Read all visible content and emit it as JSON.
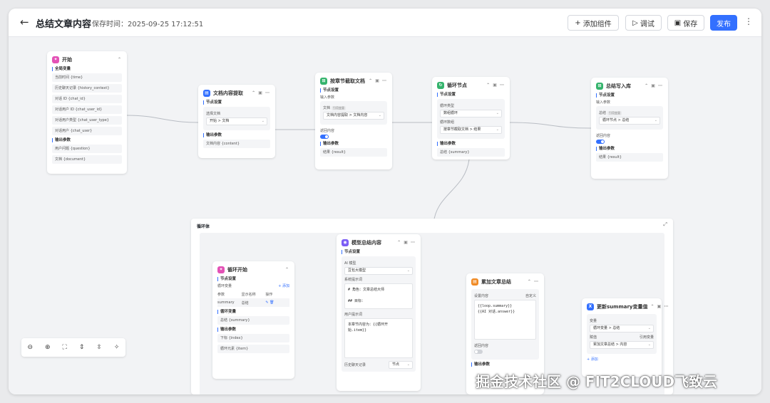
{
  "header": {
    "back_icon": "←",
    "title": "总结文章内容",
    "save_time_label": "保存时间：",
    "save_time": "2025-09-25 17:12:51",
    "add_component": "添加组件",
    "debug": "调试",
    "save": "保存",
    "publish": "发布",
    "more_icon": "⋮",
    "accent_color": "#3370ff"
  },
  "nodes": {
    "start": {
      "title": "开始",
      "global_vars_label": "全局变量",
      "global_vars": [
        "当前时间 {time}",
        "历史聊天记录 {history_context}",
        "对话 ID {chat_id}",
        "对话用户 ID {chat_user_id}",
        "对话用户类型 {chat_user_type}",
        "对话用户 {chat_user}"
      ],
      "output_label": "输出参数",
      "outputs": [
        "用户问题 {question}",
        "文档 {document}"
      ]
    },
    "doc_extract": {
      "title": "文档内容提取",
      "node_settings": "节点设置",
      "select_doc_label": "选择文档",
      "select_doc_value": "开始 > 文档",
      "output_label": "输出参数",
      "output": "文档内容 {content}"
    },
    "chapter_extract": {
      "title": "按章节截取文档",
      "node_settings": "节点设置",
      "input_label": "输入参数",
      "doc_label": "文档",
      "doc_tag": "引用变量",
      "doc_value": "文档内容提取 > 文档内容",
      "return_label": "返回内容",
      "output_label": "输出参数",
      "output": "结果 {result}"
    },
    "loop_node": {
      "title": "循环节点",
      "node_settings": "节点设置",
      "loop_type_label": "循环类型",
      "loop_type_value": "数组循环",
      "loop_array_label": "循环数组",
      "loop_array_value": "按章节截取文档 > 结果",
      "output_label": "输出参数",
      "output": "总结 {summary}"
    },
    "summary_write": {
      "title": "总结写入库",
      "node_settings": "节点设置",
      "input_label": "输入参数",
      "summary_label": "总结",
      "summary_tag": "引用变量",
      "summary_value": "循环节点 > 总结",
      "return_label": "返回内容",
      "output_label": "输出参数",
      "output": "结果 {result}"
    },
    "loop_body": {
      "title": "循环体"
    },
    "loop_start": {
      "title": "循环开始",
      "node_settings": "节点设置",
      "loop_vars_label": "循环变量",
      "add_label": "+ 添加",
      "columns": [
        "参数",
        "显示名称",
        "操作"
      ],
      "rows": [
        {
          "param": "summary",
          "name": "总结"
        }
      ],
      "loop_var_section": "循环变量",
      "loop_var_output": "总结 {summary}",
      "output_label": "输出参数",
      "outputs": [
        "下标 {index}",
        "循环元素 {item}"
      ]
    },
    "model_summary": {
      "title": "模型总结内容",
      "node_settings": "节点设置",
      "ai_model_label": "AI 模型",
      "ai_model_value": "豆包大模型",
      "system_prompt_label": "系统提示词",
      "system_prompt": "# 角色：文章总结大师\n\n## 目标：",
      "user_prompt_label": "用户提示词",
      "user_prompt": "本章节内容为：{{循环开\n始.item}}",
      "history_label": "历史聊天记录",
      "history_value": "节点"
    },
    "append_summary": {
      "title": "累加文章总结",
      "set_content_label": "设置内容",
      "set_content_mode": "自定义",
      "content": "{{loop.summary}}\n{{AI 对话.answer}}",
      "return_label": "返回内容",
      "output_label": "输出参数"
    },
    "update_var": {
      "title": "更新summary变量值",
      "var_label": "变量",
      "var_value": "循环变量 > 总结",
      "assign_label": "赋值",
      "assign_mode": "引用变量",
      "assign_value": "累加文章总结 > 内容",
      "add_label": "+ 添加"
    }
  },
  "zoom_controls": [
    "zoom-out",
    "zoom-in",
    "fit-view",
    "collapse-all",
    "expand-all",
    "beautify"
  ],
  "watermark": "掘金技术社区 @ FIT2CLOUD飞致云",
  "icon_colors": {
    "start": "#e352b6",
    "doc": "#3370ff",
    "chapter": "#34b36c",
    "loop": "#34b36c",
    "write": "#34b36c",
    "model": "#7a5cf5",
    "append": "#f08a24",
    "update": "#3370ff"
  }
}
